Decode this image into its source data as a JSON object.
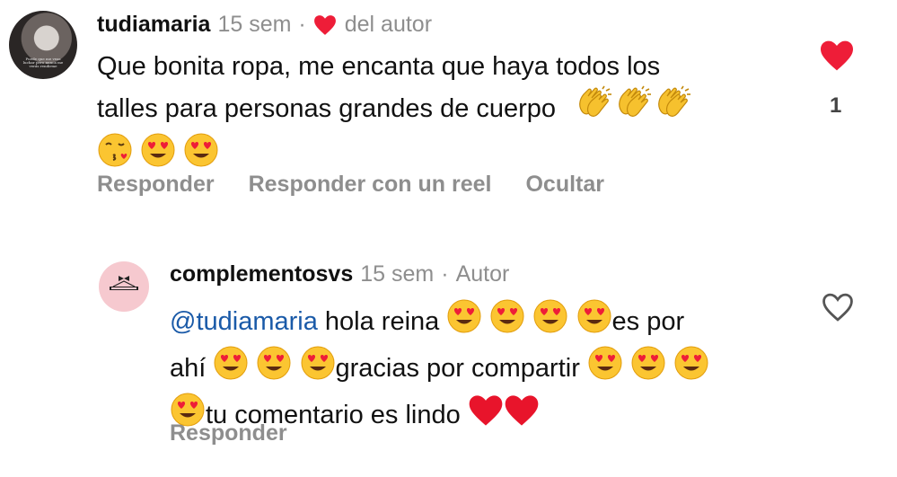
{
  "comments": [
    {
      "username": "tudiamaria",
      "time": "15 sem",
      "liked_by_author_label": "del autor",
      "avatar_caption": "Puede que me veas luchar pero nunca me verás rendirme",
      "lines": [
        "Que bonita ropa, me encanta que haya todos los",
        "talles para personas grandes de cuerpo"
      ],
      "emoji_line1_end": [
        "clapping-hands",
        "clapping-hands",
        "clapping-hands"
      ],
      "emoji_line3": [
        "face-blowing-kiss",
        "heart-eyes",
        "heart-eyes"
      ],
      "like_count": "1",
      "liked": true,
      "actions": [
        "Responder",
        "Responder con un reel",
        "Ocultar"
      ]
    },
    {
      "username": "complementosvs",
      "time": "15 sem",
      "role": "Autor",
      "mention": "@tudiamaria",
      "segments": {
        "s1": " hola reina ",
        "s2": "es por",
        "s3": "ahí ",
        "s4": "gracias por compartir ",
        "s5": "tu comentario es lindo "
      },
      "liked": false,
      "actions": [
        "Responder"
      ]
    }
  ],
  "colors": {
    "heart_red": "#ee1d38",
    "muted": "#8e8e8e",
    "mention": "#1a5aa8",
    "avatar_pink": "#f6c9cf"
  }
}
